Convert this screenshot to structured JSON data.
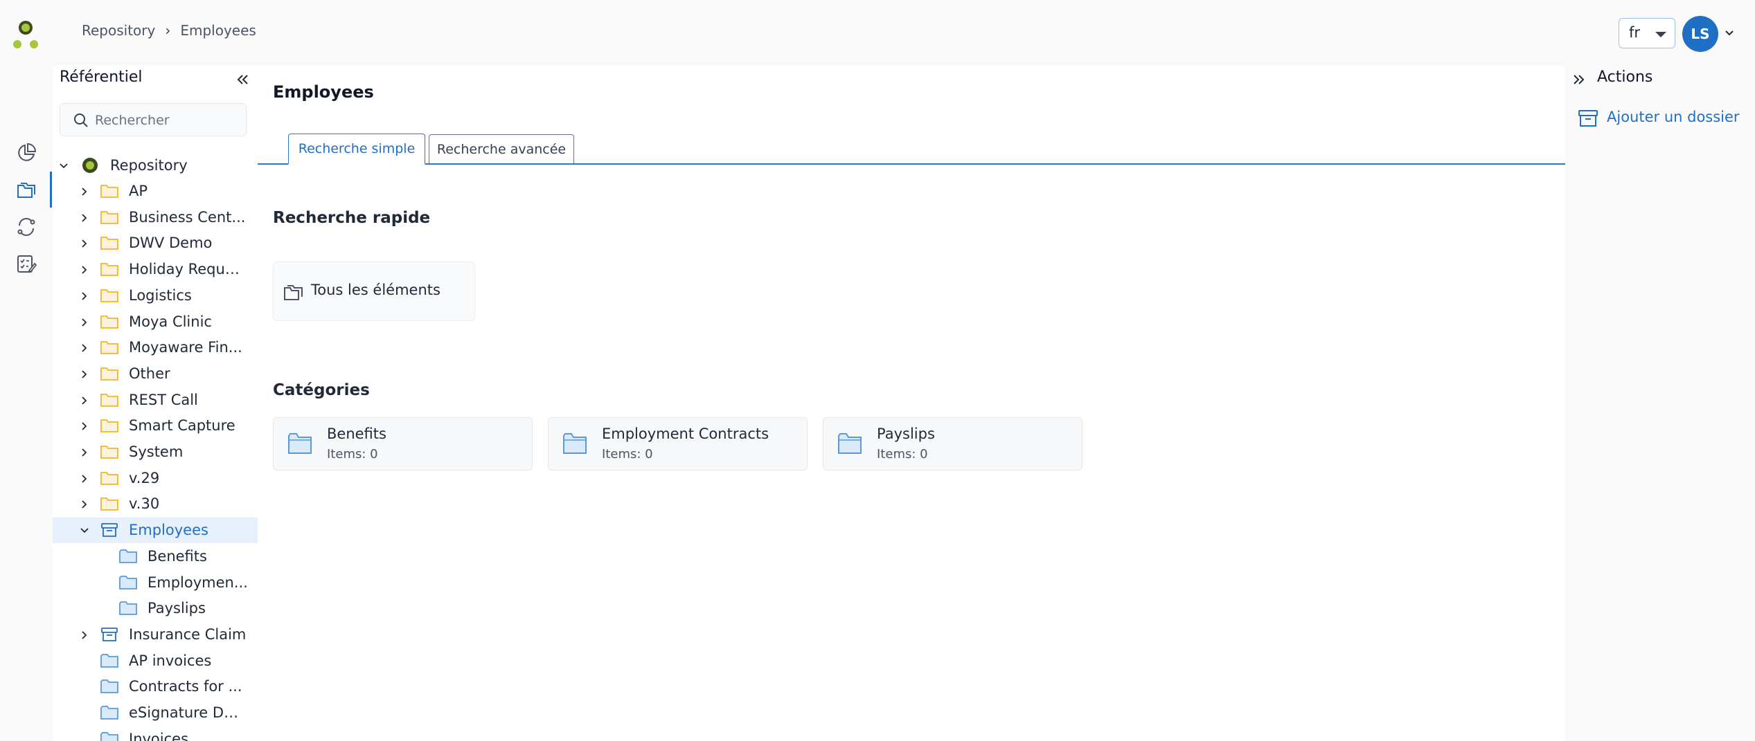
{
  "header": {
    "breadcrumb": [
      "Repository",
      "Employees"
    ],
    "language": "fr",
    "user_initials": "LS"
  },
  "tree": {
    "title": "Référentiel",
    "search_placeholder": "Rechercher",
    "root": "Repository",
    "items": [
      {
        "label": "AP",
        "type": "folder"
      },
      {
        "label": "Business Cent...",
        "type": "folder"
      },
      {
        "label": "DWV Demo",
        "type": "folder"
      },
      {
        "label": "Holiday Reque...",
        "type": "folder"
      },
      {
        "label": "Logistics",
        "type": "folder"
      },
      {
        "label": "Moya Clinic",
        "type": "folder"
      },
      {
        "label": "Moyaware Fin...",
        "type": "folder"
      },
      {
        "label": "Other",
        "type": "folder"
      },
      {
        "label": "REST Call",
        "type": "folder"
      },
      {
        "label": "Smart Capture",
        "type": "folder"
      },
      {
        "label": "System",
        "type": "folder"
      },
      {
        "label": "v.29",
        "type": "folder"
      },
      {
        "label": "v.30",
        "type": "folder"
      },
      {
        "label": "Employees",
        "type": "archive",
        "selected": true
      },
      {
        "label": "Benefits",
        "type": "category"
      },
      {
        "label": "Employmen...",
        "type": "category"
      },
      {
        "label": "Payslips",
        "type": "category"
      },
      {
        "label": "Insurance Claim",
        "type": "archive"
      },
      {
        "label": "AP invoices",
        "type": "category"
      },
      {
        "label": "Contracts for ...",
        "type": "category"
      },
      {
        "label": "eSignature De...",
        "type": "category"
      },
      {
        "label": "Invoices",
        "type": "category"
      }
    ]
  },
  "main": {
    "title": "Employees",
    "tabs": [
      {
        "label": "Recherche simple",
        "active": true
      },
      {
        "label": "Recherche avancée",
        "active": false
      }
    ],
    "quick_search_title": "Recherche rapide",
    "quick_search_item": "Tous les éléments",
    "categories_title": "Catégories",
    "categories": [
      {
        "name": "Benefits",
        "count": "Items: 0"
      },
      {
        "name": "Employment Contracts",
        "count": "Items: 0"
      },
      {
        "name": "Payslips",
        "count": "Items: 0"
      }
    ]
  },
  "actions": {
    "title": "Actions",
    "add_folder": "Ajouter un dossier"
  },
  "colors": {
    "accent": "#1f6fc4",
    "folder": "#f2b52d",
    "category": "#5a9ad8",
    "logo_green": "#a4c639"
  }
}
